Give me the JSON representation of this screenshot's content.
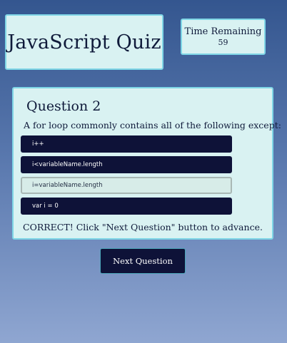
{
  "header": {
    "title": "JavaScript Quiz"
  },
  "timer": {
    "label": "Time Remaining",
    "value": "59"
  },
  "question": {
    "heading": "Question 2",
    "text": "A for loop commonly contains all of the following except:",
    "answers": [
      "i++",
      "i<variableName.length",
      "i=variableName.length",
      "var i = 0"
    ],
    "selected_answer": "i=variableName.length",
    "feedback": "CORRECT! Click \"Next Question\" button to advance."
  },
  "next_button": {
    "label": "Next Question"
  },
  "colors": {
    "panel_bg": "#d9f2f2",
    "panel_border": "#7fd6e6",
    "button_bg": "#0e1238",
    "selected_answer_bg": "#d7ece8"
  }
}
